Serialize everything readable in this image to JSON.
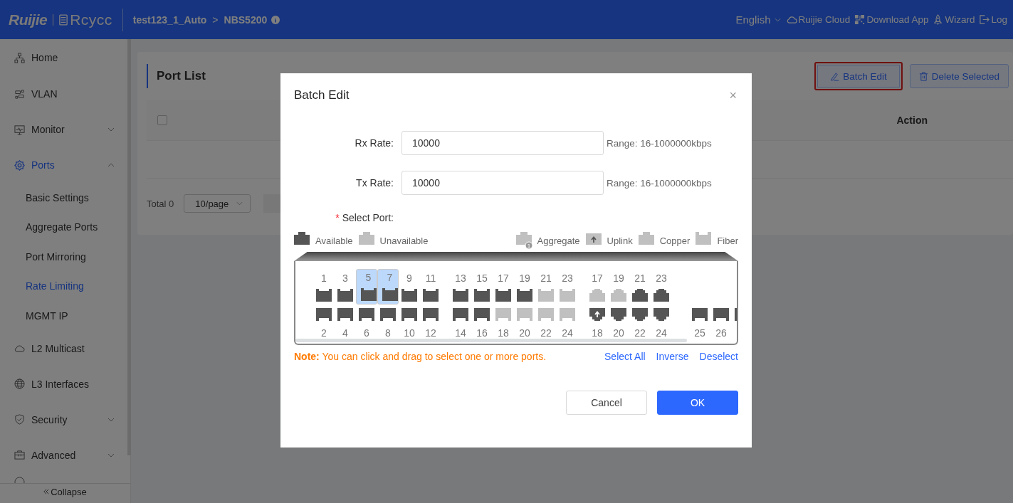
{
  "header": {
    "logo": "Ruijie",
    "sub_logo": "Rcycc",
    "breadcrumb": [
      "test123_1_Auto",
      "NBS5200"
    ],
    "breadcrumb_separator": ">",
    "nav": [
      {
        "kind": "language",
        "label": "English"
      },
      {
        "kind": "cloud",
        "label": "Ruijie Cloud"
      },
      {
        "kind": "qr",
        "label": "Download App"
      },
      {
        "kind": "wizard",
        "label": "Wizard"
      },
      {
        "kind": "logout",
        "label": "Log"
      }
    ]
  },
  "sidebar": {
    "items": [
      {
        "label": "Home",
        "selected": false
      },
      {
        "label": "VLAN",
        "selected": false
      },
      {
        "label": "Monitor",
        "selected": false,
        "expanded": false
      },
      {
        "label": "Ports",
        "selected": true,
        "expanded": true,
        "children": [
          {
            "label": "Basic Settings",
            "selected": false
          },
          {
            "label": "Aggregate Ports",
            "selected": false
          },
          {
            "label": "Port Mirroring",
            "selected": false
          },
          {
            "label": "Rate Limiting",
            "selected": true
          },
          {
            "label": "MGMT IP",
            "selected": false
          }
        ]
      },
      {
        "label": "L2 Multicast",
        "selected": false
      },
      {
        "label": "L3 Interfaces",
        "selected": false
      },
      {
        "label": "Security",
        "selected": false,
        "expanded": false
      },
      {
        "label": "Advanced",
        "selected": false,
        "expanded": false
      }
    ],
    "collapse": "Collapse"
  },
  "card": {
    "title": "Port List",
    "buttons": [
      {
        "kind": "edit",
        "label": "Batch Edit",
        "highlighted": true
      },
      {
        "kind": "delete",
        "label": "Delete Selected",
        "highlighted": false
      }
    ],
    "table": {
      "select_all_checked": false,
      "columns": [
        "Action"
      ]
    },
    "pagination": {
      "total": "Total 0",
      "page_size": "10/page"
    }
  },
  "dialog": {
    "title": "Batch Edit",
    "close": "×",
    "fields": [
      {
        "label": "Rx Rate:",
        "value": "10000",
        "hint": "Range: 16-1000000kbps"
      },
      {
        "label": "Tx Rate:",
        "value": "10000",
        "hint": "Range: 16-1000000kbps"
      }
    ],
    "select_port": {
      "required_mark": "*",
      "label": "Select Port:"
    },
    "legend": [
      {
        "kind": "available",
        "label": "Available"
      },
      {
        "kind": "unavailable",
        "label": "Unavailable"
      },
      {
        "kind": "aggregate",
        "label": "Aggregate",
        "badge": "1"
      },
      {
        "kind": "uplink",
        "label": "Uplink"
      },
      {
        "kind": "copper",
        "label": "Copper"
      },
      {
        "kind": "fiber",
        "label": "Fiber"
      }
    ],
    "port_groups": [
      {
        "top": [
          {
            "label": "1",
            "kind": "rj45",
            "available": true,
            "selected": false
          },
          {
            "label": "3",
            "kind": "rj45",
            "available": true,
            "selected": false
          },
          {
            "label": "5",
            "kind": "rj45",
            "available": true,
            "selected": true
          },
          {
            "label": "7",
            "kind": "rj45",
            "available": true,
            "selected": true
          },
          {
            "label": "9",
            "kind": "rj45",
            "available": true,
            "selected": false
          },
          {
            "label": "11",
            "kind": "rj45",
            "available": true,
            "selected": false
          }
        ],
        "bottom": [
          {
            "label": "2",
            "kind": "rj45",
            "available": true,
            "selected": false
          },
          {
            "label": "4",
            "kind": "rj45",
            "available": true,
            "selected": false
          },
          {
            "label": "6",
            "kind": "rj45",
            "available": true,
            "selected": false
          },
          {
            "label": "8",
            "kind": "rj45",
            "available": true,
            "selected": false
          },
          {
            "label": "10",
            "kind": "rj45",
            "available": true,
            "selected": false
          },
          {
            "label": "12",
            "kind": "rj45",
            "available": true,
            "selected": false
          }
        ]
      },
      {
        "top": [
          {
            "label": "13",
            "kind": "rj45",
            "available": true,
            "selected": false
          },
          {
            "label": "15",
            "kind": "rj45",
            "available": true,
            "selected": false
          },
          {
            "label": "17",
            "kind": "rj45",
            "available": true,
            "selected": false
          },
          {
            "label": "19",
            "kind": "rj45",
            "available": true,
            "selected": false
          },
          {
            "label": "21",
            "kind": "rj45",
            "available": false,
            "selected": false
          },
          {
            "label": "23",
            "kind": "rj45",
            "available": false,
            "selected": false
          }
        ],
        "bottom": [
          {
            "label": "14",
            "kind": "rj45",
            "available": true,
            "selected": false
          },
          {
            "label": "16",
            "kind": "rj45",
            "available": true,
            "selected": false
          },
          {
            "label": "18",
            "kind": "rj45",
            "available": false,
            "selected": false
          },
          {
            "label": "20",
            "kind": "rj45",
            "available": false,
            "selected": false
          },
          {
            "label": "22",
            "kind": "rj45",
            "available": false,
            "selected": false
          },
          {
            "label": "24",
            "kind": "rj45",
            "available": false,
            "selected": false
          }
        ]
      },
      {
        "top": [
          {
            "label": "17",
            "kind": "copper",
            "available": false,
            "selected": false
          },
          {
            "label": "19",
            "kind": "copper",
            "available": false,
            "selected": false
          },
          {
            "label": "21",
            "kind": "copper",
            "available": true,
            "selected": false
          },
          {
            "label": "23",
            "kind": "copper",
            "available": true,
            "selected": false
          }
        ],
        "bottom": [
          {
            "label": "18",
            "kind": "copper",
            "available": true,
            "selected": false,
            "uplink": true
          },
          {
            "label": "20",
            "kind": "copper",
            "available": true,
            "selected": false
          },
          {
            "label": "22",
            "kind": "copper",
            "available": true,
            "selected": false
          },
          {
            "label": "24",
            "kind": "copper",
            "available": true,
            "selected": false
          }
        ]
      },
      {
        "bottom": [
          {
            "label": "25",
            "kind": "fiber",
            "available": true,
            "selected": false
          },
          {
            "label": "26",
            "kind": "fiber",
            "available": true,
            "selected": false
          },
          {
            "kind": "fiber",
            "available": true,
            "selected": false
          }
        ]
      }
    ],
    "note": {
      "lead": "Note:",
      "text": "You can click and drag to select one or more ports."
    },
    "links": [
      "Select All",
      "Inverse",
      "Deselect"
    ],
    "buttons": [
      {
        "kind": "secondary",
        "label": "Cancel"
      },
      {
        "kind": "primary",
        "label": "OK"
      }
    ]
  }
}
